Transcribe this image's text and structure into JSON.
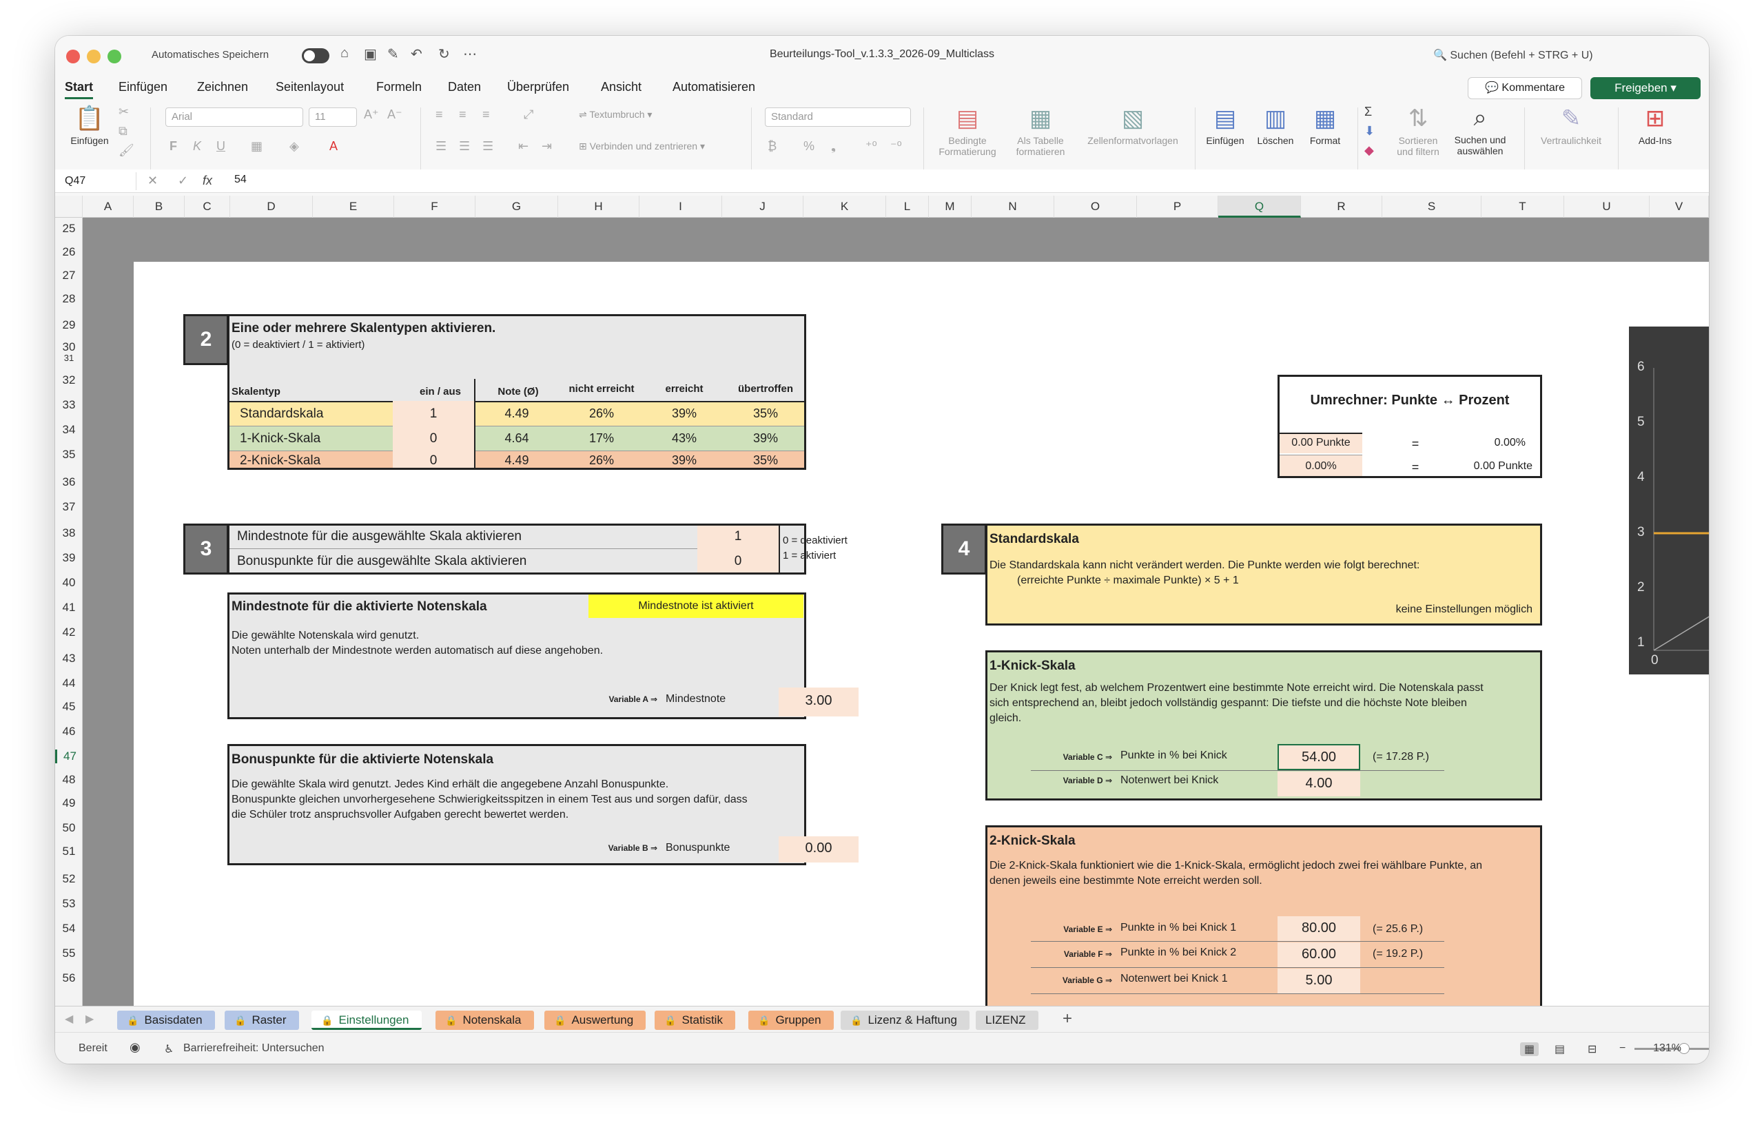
{
  "titlebar": {
    "autosave_label": "Automatisches Speichern",
    "document_title": "Beurteilungs-Tool_v.1.3.3_2026-09_Multiclass",
    "search_placeholder": "Suchen (Befehl + STRG + U)"
  },
  "ribbon_tabs": [
    "Start",
    "Einfügen",
    "Zeichnen",
    "Seitenlayout",
    "Formeln",
    "Daten",
    "Überprüfen",
    "Ansicht",
    "Automatisieren"
  ],
  "ribbon_buttons": {
    "comments": "Kommentare",
    "share": "Freigeben",
    "paste": "Einfügen",
    "font_name": "Arial",
    "font_size": "11",
    "wrap_text": "Textumbruch",
    "merge_center": "Verbinden und zentrieren",
    "number_format": "Standard",
    "conditional_formatting": "Bedingte Formatierung",
    "format_as_table": "Als Tabelle formatieren",
    "cell_styles": "Zellenformatvorlagen",
    "insert": "Einfügen",
    "delete": "Löschen",
    "format": "Format",
    "sort_filter": "Sortieren und filtern",
    "find_select": "Suchen und auswählen",
    "sensitivity": "Vertraulichkeit",
    "addins": "Add-Ins"
  },
  "formula_bar": {
    "name_box": "Q47",
    "value": "54"
  },
  "columns": [
    "A",
    "B",
    "C",
    "D",
    "E",
    "F",
    "G",
    "H",
    "I",
    "J",
    "K",
    "L",
    "M",
    "N",
    "O",
    "P",
    "Q",
    "R",
    "S",
    "T",
    "U",
    "V"
  ],
  "rows": [
    "25",
    "26",
    "27",
    "28",
    "29",
    "30",
    "31",
    "32",
    "33",
    "34",
    "35",
    "36",
    "37",
    "38",
    "39",
    "40",
    "41",
    "42",
    "43",
    "44",
    "45",
    "46",
    "47",
    "48",
    "49",
    "50",
    "51",
    "52",
    "53",
    "54",
    "55",
    "56"
  ],
  "section2": {
    "number": "2",
    "title": "Eine oder mehrere Skalentypen aktivieren.",
    "subtitle": "(0 = deaktiviert / 1 = aktiviert)",
    "headers": [
      "Skalentyp",
      "ein / aus",
      "Note (Ø)",
      "nicht erreicht",
      "erreicht",
      "übertroffen"
    ],
    "rows": [
      {
        "name": "Standardskala",
        "onoff": "1",
        "note": "4.49",
        "ne": "26%",
        "e": "39%",
        "u": "35%"
      },
      {
        "name": "1-Knick-Skala",
        "onoff": "0",
        "note": "4.64",
        "ne": "17%",
        "e": "43%",
        "u": "39%"
      },
      {
        "name": "2-Knick-Skala",
        "onoff": "0",
        "note": "4.49",
        "ne": "26%",
        "e": "39%",
        "u": "35%"
      }
    ]
  },
  "converter": {
    "title": "Umrechner: Punkte ↔ Prozent",
    "row1_left": "0.00 Punkte",
    "row1_eq": "=",
    "row1_right": "0.00%",
    "row2_left": "0.00%",
    "row2_eq": "=",
    "row2_right": "0.00 Punkte"
  },
  "section3": {
    "number": "3",
    "row1_label": "Mindestnote für die ausgewählte Skala aktivieren",
    "row1_value": "1",
    "row2_label": "Bonuspunkte für die ausgewählte Skala aktivieren",
    "row2_value": "0",
    "legend1": "0 = deaktiviert",
    "legend2": "1 = aktiviert"
  },
  "mindestnote": {
    "title": "Mindestnote für die aktivierte Notenskala",
    "status": "Mindestnote ist aktiviert",
    "line1": "Die gewählte Notenskala wird genutzt.",
    "line2": "Noten unterhalb der Mindestnote werden automatisch auf diese angehoben.",
    "var_label": "Variable A ⇒",
    "field_label": "Mindestnote",
    "value": "3.00"
  },
  "bonus": {
    "title": "Bonuspunkte für die aktivierte Notenskala",
    "line1": "Die gewählte Skala wird genutzt. Jedes Kind erhält die angegebene Anzahl Bonuspunkte.",
    "line2": "Bonuspunkte gleichen unvorhergesehene Schwierigkeitsspitzen in einem Test aus und sorgen dafür, dass",
    "line3": "die Schüler trotz anspruchsvoller Aufgaben gerecht bewertet werden.",
    "var_label": "Variable B ⇒",
    "field_label": "Bonuspunkte",
    "value": "0.00"
  },
  "section4": {
    "number": "4",
    "title": "Standardskala",
    "line1": "Die Standardskala kann nicht verändert werden. Die Punkte werden wie folgt berechnet:",
    "line2": "(erreichte Punkte ÷ maximale Punkte) × 5 + 1",
    "note": "keine Einstellungen möglich"
  },
  "knick1": {
    "title": "1-Knick-Skala",
    "line1": "Der Knick legt fest, ab welchem Prozentwert eine bestimmte Note erreicht wird. Die Notenskala passt",
    "line2": "sich entsprechend an, bleibt jedoch vollständig gespannt: Die tiefste und die höchste Note bleiben",
    "line3": "gleich.",
    "varC": "Variable C ⇒",
    "labelC": "Punkte in % bei Knick",
    "valueC": "54.00",
    "noteC": "(= 17.28 P.)",
    "varD": "Variable D ⇒",
    "labelD": "Notenwert bei Knick",
    "valueD": "4.00"
  },
  "knick2": {
    "title": "2-Knick-Skala",
    "line1": "Die 2-Knick-Skala funktioniert wie die 1-Knick-Skala, ermöglicht jedoch zwei frei wählbare Punkte, an",
    "line2": "denen jeweils eine bestimmte Note erreicht werden soll.",
    "varE": "Variable E ⇒",
    "labelE": "Punkte in % bei Knick 1",
    "valueE": "80.00",
    "noteE": "(= 25.6 P.)",
    "varF": "Variable F ⇒",
    "labelF": "Punkte in % bei Knick 2",
    "valueF": "60.00",
    "noteF": "(= 19.2 P.)",
    "varG": "Variable G ⇒",
    "labelG": "Notenwert bei Knick 1",
    "valueG": "5.00"
  },
  "chart_ticks": [
    "6",
    "5",
    "4",
    "3",
    "2",
    "1",
    "0"
  ],
  "sheet_tabs": [
    {
      "label": "Basisdaten",
      "color": "#b4c6e7"
    },
    {
      "label": "Raster",
      "color": "#b4c6e7"
    },
    {
      "label": "Einstellungen",
      "color": "#ffffff"
    },
    {
      "label": "Notenskala",
      "color": "#f4b183"
    },
    {
      "label": "Auswertung",
      "color": "#f4b183"
    },
    {
      "label": "Statistik",
      "color": "#f4b183"
    },
    {
      "label": "Gruppen",
      "color": "#f4b183"
    },
    {
      "label": "Lizenz & Haftung",
      "color": "#d9d9d9"
    },
    {
      "label": "LIZENZ",
      "color": "#d9d9d9"
    }
  ],
  "statusbar": {
    "ready": "Bereit",
    "accessibility": "Barrierefreiheit: Untersuchen",
    "zoom": "131%"
  },
  "colors": {
    "accent_green": "#1e7145",
    "standard_yellow": "#fde9a6",
    "knick1_green": "#cfe1bb",
    "knick2_orange": "#f6c7a6",
    "peach_input": "#fbe5d6",
    "highlight_yellow": "#ffff33"
  }
}
